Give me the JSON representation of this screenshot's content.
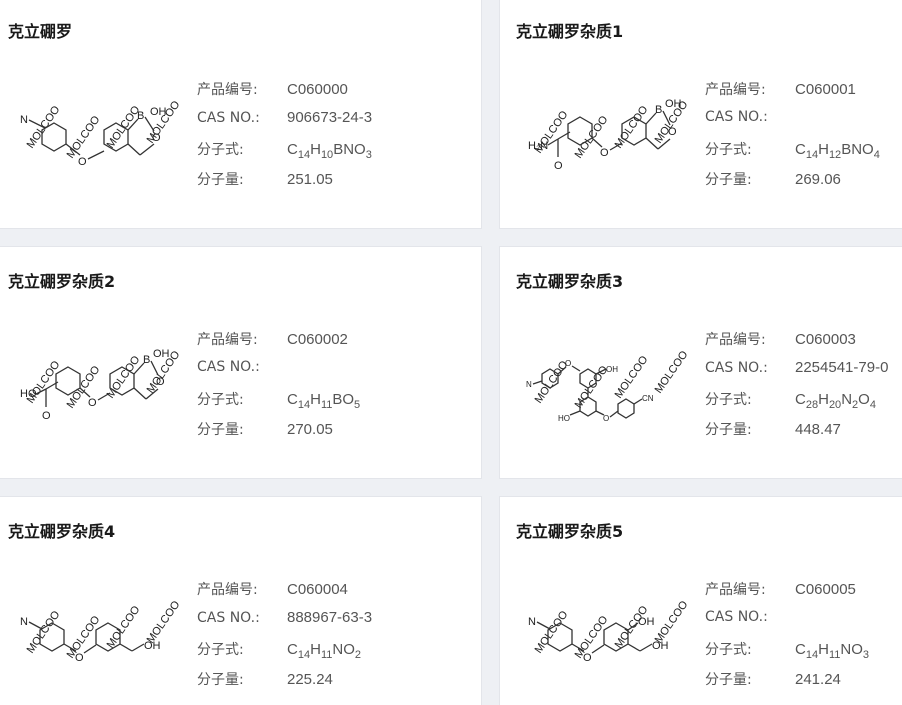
{
  "labels": {
    "product_no": "产品编号:",
    "cas": "CAS NO.:",
    "formula": "分子式:",
    "mw": "分子量:"
  },
  "watermark": "MOLCOO",
  "products": [
    {
      "name": "克立硼罗",
      "product_no": "C060000",
      "cas": "906673-24-3",
      "formula": [
        {
          "t": "C"
        },
        {
          "s": "14"
        },
        {
          "t": "H"
        },
        {
          "s": "10"
        },
        {
          "t": "BNO"
        },
        {
          "s": "3"
        }
      ],
      "mw": "251.05",
      "structure_icon": "crisaborole-structure"
    },
    {
      "name": "克立硼罗杂质1",
      "product_no": "C060001",
      "cas": "",
      "formula": [
        {
          "t": "C"
        },
        {
          "s": "14"
        },
        {
          "t": "H"
        },
        {
          "s": "12"
        },
        {
          "t": "BNO"
        },
        {
          "s": "4"
        }
      ],
      "mw": "269.06",
      "structure_icon": "amide-impurity-structure"
    },
    {
      "name": "克立硼罗杂质2",
      "product_no": "C060002",
      "cas": "",
      "formula": [
        {
          "t": "C"
        },
        {
          "s": "14"
        },
        {
          "t": "H"
        },
        {
          "s": "11"
        },
        {
          "t": "BO"
        },
        {
          "s": "5"
        }
      ],
      "mw": "270.05",
      "structure_icon": "acid-impurity-structure"
    },
    {
      "name": "克立硼罗杂质3",
      "product_no": "C060003",
      "cas": "2254541-79-0",
      "formula": [
        {
          "t": "C"
        },
        {
          "s": "28"
        },
        {
          "t": "H"
        },
        {
          "s": "20"
        },
        {
          "t": "N"
        },
        {
          "s": "2"
        },
        {
          "t": "O"
        },
        {
          "s": "4"
        }
      ],
      "mw": "448.47",
      "structure_icon": "dimer-impurity-structure"
    },
    {
      "name": "克立硼罗杂质4",
      "product_no": "C060004",
      "cas": "888967-63-3",
      "formula": [
        {
          "t": "C"
        },
        {
          "s": "14"
        },
        {
          "t": "H"
        },
        {
          "s": "11"
        },
        {
          "t": "NO"
        },
        {
          "s": "2"
        }
      ],
      "mw": "225.24",
      "structure_icon": "alcohol-impurity-structure"
    },
    {
      "name": "克立硼罗杂质5",
      "product_no": "C060005",
      "cas": "",
      "formula": [
        {
          "t": "C"
        },
        {
          "s": "14"
        },
        {
          "t": "H"
        },
        {
          "s": "11"
        },
        {
          "t": "NO"
        },
        {
          "s": "3"
        }
      ],
      "mw": "241.24",
      "structure_icon": "phenol-impurity-structure"
    }
  ],
  "structure_labels": {
    "oh": "OH",
    "b": "B",
    "o": "O",
    "n": "N",
    "h2n": "H₂N",
    "ho": "HO",
    "cn": "CN"
  }
}
